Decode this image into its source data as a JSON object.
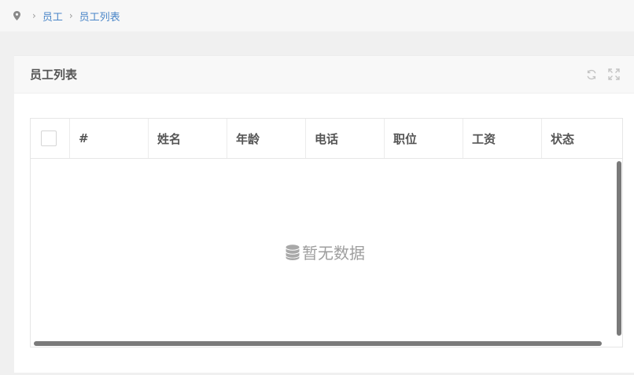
{
  "breadcrumb": {
    "items": [
      "员工",
      "员工列表"
    ],
    "separator": "›"
  },
  "panel": {
    "title": "员工列表"
  },
  "table": {
    "columns": [
      "#",
      "姓名",
      "年龄",
      "电话",
      "职位",
      "工资",
      "状态"
    ],
    "rows": [],
    "empty_text": "暂无数据"
  },
  "icons": {
    "location": "location-pin-icon",
    "refresh": "refresh-icon",
    "fullscreen": "fullscreen-icon",
    "database": "database-icon"
  },
  "colors": {
    "link": "#4a86c8",
    "tab_accent": "#5b8fd0"
  }
}
